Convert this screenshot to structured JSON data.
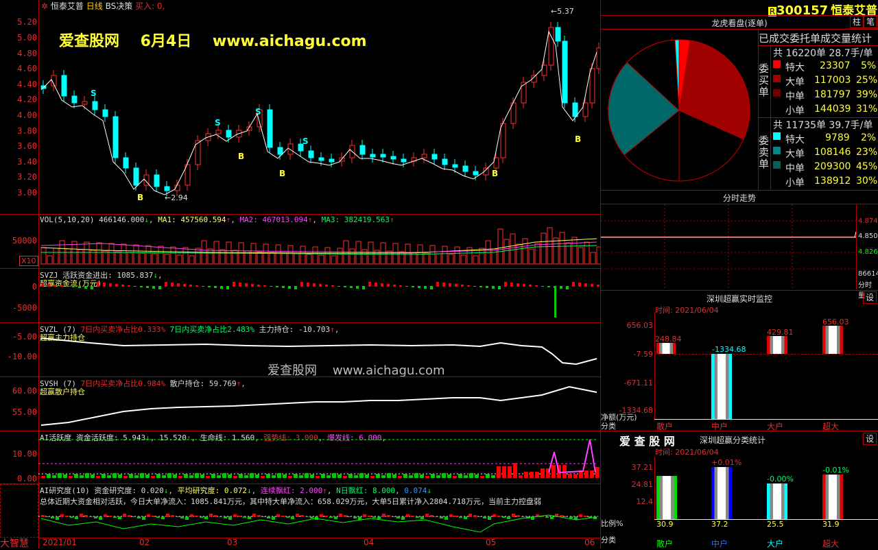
{
  "header": {
    "stock_name": "恒泰艾普",
    "period": "日线",
    "strategy": "BS决策",
    "signal": "买入: 0,",
    "watermark_title": "爱查股网    6月4日    www.aichagu.com",
    "watermark_mid": "爱查股网    www.aichagu.com",
    "high_marker": "5.37",
    "low_marker": "2.94",
    "buy_marker": "B",
    "sell_marker": "S"
  },
  "price_axis": [
    "5.20",
    "5.00",
    "4.80",
    "4.60",
    "4.40",
    "4.20",
    "4.00",
    "3.80",
    "3.60",
    "3.40",
    "3.20",
    "3.00"
  ],
  "vol": {
    "title": "VOL(5,10,20)",
    "value": "466146.000",
    "ma1": "MA1: 457560.594",
    "ma2": "MA2: 467013.094",
    "ma3": "MA3: 382419.563",
    "axis": "50000",
    "unit": "X10"
  },
  "svzj": {
    "title": "SVZJ  活跃资金进出: 1085.837",
    "sub": "超赢资金流(万元)",
    "axis": [
      "0",
      "-5000"
    ]
  },
  "svzl": {
    "title": "SVZL (7)",
    "t1": "7日内买卖净占比0.333%",
    "t2": "7日内买卖净占比2.483%",
    "t3": "主力持仓: -10.703",
    "sub": "超赢主力持仓",
    "axis": [
      "-5.00",
      "-10.00"
    ]
  },
  "svsh": {
    "title": "SVSH (7)",
    "t1": "7日内买卖净占比0.984%",
    "t2": "散户持仓: 59.769",
    "sub": "超赢散户持仓",
    "axis": [
      "60.00",
      "55.00"
    ]
  },
  "ai": {
    "title": "AI活跃度",
    "t1": "资金活跃度: 5.943",
    "t2": "15.520",
    "t3": "生命线: 1.560",
    "t4": "强势线: 3.000",
    "t5": "爆发线: 6.000",
    "axis": [
      "10.00",
      "0.00"
    ]
  },
  "air": {
    "title": "AI研究度(10)",
    "t1": "资金研究度: 0.020",
    "t2": "平均研究度: 0.072",
    "t3": "连续飘红: 2.000",
    "t4": "N日飘红: 8.000",
    "t5": "0.074",
    "summary": "总体近期大资金相对活跃，今日大单净流入：1085.841万元，其中特大单净流入：658.029万元，大单5日累计净入2804.718万元，当前主力控盘弱",
    "app_name": "大智慧"
  },
  "x_axis": [
    "2021/01",
    "02",
    "03",
    "04",
    "05",
    "06"
  ],
  "right": {
    "code": "300157",
    "name": "恒泰艾普",
    "btn_zhu": "柱",
    "btn_bi": "笔",
    "pie_title": "龙虎看盘(逐单)",
    "stat_title": "已成交委托单成交量统计",
    "buy_label": "委买单",
    "sell_label": "委卖单",
    "buy_total": "共 16220单 28.7手/单",
    "sell_total": "共 11735单 39.7手/单",
    "buy_rows": [
      {
        "name": "特大",
        "vol": "23307",
        "pct": "5%",
        "color": "#ff0000"
      },
      {
        "name": "大单",
        "vol": "117003",
        "pct": "25%",
        "color": "#a00000"
      },
      {
        "name": "中单",
        "vol": "181797",
        "pct": "39%",
        "color": "#700000"
      },
      {
        "name": "小单",
        "vol": "144039",
        "pct": "31%",
        "color": "#000000"
      }
    ],
    "sell_rows": [
      {
        "name": "特大",
        "vol": "9789",
        "pct": "2%",
        "color": "#00ffff"
      },
      {
        "name": "大单",
        "vol": "108146",
        "pct": "23%",
        "color": "#008888"
      },
      {
        "name": "中单",
        "vol": "209300",
        "pct": "45%",
        "color": "#006060"
      },
      {
        "name": "小单",
        "vol": "138912",
        "pct": "30%",
        "color": "#000000"
      }
    ],
    "intraday_title": "分时走势",
    "intraday_axis": [
      "4.874",
      "4.850",
      "4.826",
      "86614",
      "分时量"
    ],
    "monitor_title": "深圳超赢实时监控",
    "monitor_set": "设",
    "monitor_time": "时间: 2021/06/04",
    "monitor_axis": [
      "656.03",
      "-7.59",
      "-671.11",
      "-1334.68"
    ],
    "monitor_unit": "净额(万元)",
    "monitor_cat": "分类",
    "cats": [
      "散户",
      "中户",
      "大户",
      "超大"
    ],
    "monitor_values": [
      "248.84",
      "-1334.68",
      "429.81",
      "656.03"
    ],
    "class_brand": "爱 查 股 网",
    "class_title": "深圳超赢分类统计",
    "class_time": "时间: 2021/06/04",
    "class_axis": [
      "37.21",
      "24.81",
      "12.4"
    ],
    "class_ratio_label": "比例%",
    "class_cat": "分类",
    "class_changes": [
      "+0.01%",
      "-0.00%",
      "-0.01%"
    ],
    "class_values": [
      "30.9",
      "37.2",
      "25.5",
      "31.9"
    ]
  }
}
